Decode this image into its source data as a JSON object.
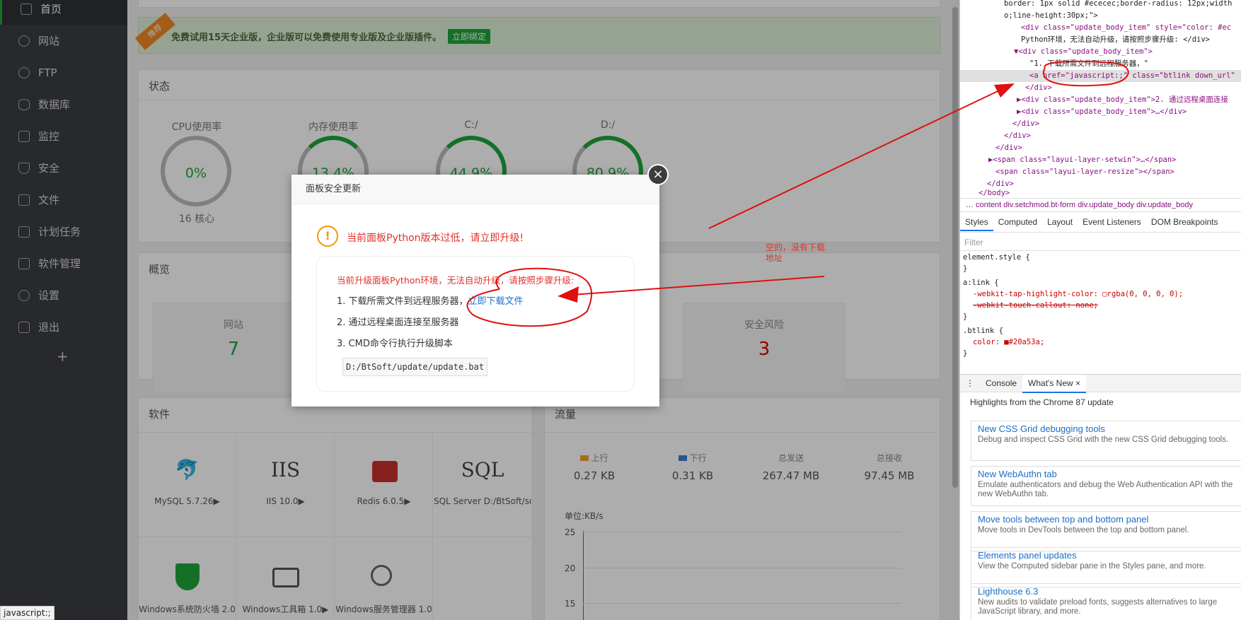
{
  "sidebar": {
    "items": [
      {
        "label": "首页",
        "icon": "home-icon"
      },
      {
        "label": "网站",
        "icon": "globe-icon"
      },
      {
        "label": "FTP",
        "icon": "ftp-icon"
      },
      {
        "label": "数据库",
        "icon": "database-icon"
      },
      {
        "label": "监控",
        "icon": "monitor-icon"
      },
      {
        "label": "安全",
        "icon": "shield-icon"
      },
      {
        "label": "文件",
        "icon": "folder-icon"
      },
      {
        "label": "计划任务",
        "icon": "calendar-icon"
      },
      {
        "label": "软件管理",
        "icon": "grid-icon"
      },
      {
        "label": "设置",
        "icon": "gear-icon"
      },
      {
        "label": "退出",
        "icon": "logout-icon"
      }
    ],
    "add": "+"
  },
  "promo": {
    "tag": "推荐",
    "text": "免费试用15天企业版，企业版可以免费使用专业版及企业版插件。",
    "button": "立即绑定"
  },
  "status": {
    "title": "状态",
    "gauges": [
      {
        "label": "CPU使用率",
        "value": "0%",
        "sub": "16 核心",
        "percent": 0
      },
      {
        "label": "内存使用率",
        "value": "13.4%",
        "sub": "",
        "percent": 13.4
      },
      {
        "label": "C:/",
        "value": "44.9%",
        "sub": "",
        "percent": 44.9
      },
      {
        "label": "D:/",
        "value": "80.9%",
        "sub": "",
        "percent": 80.9
      }
    ]
  },
  "overview": {
    "title": "概览",
    "boxes": [
      {
        "label": "网站",
        "value": "7"
      },
      {
        "label": "安全风险",
        "value": "3"
      }
    ]
  },
  "software": {
    "title": "软件",
    "items": [
      {
        "logo": "🐬",
        "name": "MySQL 5.7.26▶"
      },
      {
        "logo": "IIS",
        "name": "IIS 10.0▶"
      },
      {
        "logo": "",
        "name": "Redis 6.0.5▶"
      },
      {
        "logo": "SQL",
        "name": "SQL Server D:/BtSoft/sqlserver/versi"
      },
      {
        "logo": "",
        "name": "Windows系统防火墙 2.0"
      },
      {
        "logo": "",
        "name": "Windows工具箱 1.0▶"
      },
      {
        "logo": "",
        "name": "Windows服务管理器 1.0"
      }
    ]
  },
  "flow": {
    "title": "流量",
    "stats": [
      {
        "label": "上行",
        "value": "0.27 KB",
        "color": "#f0a030"
      },
      {
        "label": "下行",
        "value": "0.31 KB",
        "color": "#3a7fd5"
      },
      {
        "label": "总发送",
        "value": "267.47 MB"
      },
      {
        "label": "总接收",
        "value": "97.45 MB"
      }
    ],
    "unit": "单位:KB/s",
    "y_ticks": [
      "25",
      "20",
      "15"
    ]
  },
  "modal": {
    "title": "面板安全更新",
    "warning": "当前面板Python版本过低，请立即升级!",
    "intro": "当前升级面板Python环境，无法自动升级，请按照步骤升级:",
    "step1": "1. 下载所需文件到远程服务器，",
    "step1_link": "立即下载文件",
    "step2": "2. 通过远程桌面连接至服务器",
    "step3": "3. CMD命令行执行升级脚本",
    "code": "D:/BtSoft/update/update.bat",
    "close": "×"
  },
  "annotation": {
    "line1": "空的，没有下载",
    "line2": "地址"
  },
  "status_tip": "javascript:;",
  "devtools": {
    "dom": [
      "border: 1px solid #ececec;border-radius: 12px;width",
      "o;line-height:30px;\">",
      "<div class=\"update_body_item\" style=\"color: #ec",
      "Python环境，无法自动升级，请按照步骤升级: </div>",
      "▼<div class=\"update_body_item\">",
      "\"1. 下载所需文件到远程服务器，\"",
      "<a href=\"javascript:;\" class=\"btlink down_url\"",
      "</div>",
      "▶<div class=\"update_body_item\">2. 通过远程桌面连接",
      "▶<div class=\"update_body_item\">…</div>",
      "</div>",
      "</div>",
      "</div>",
      "▶<span class=\"layui-layer-setwin\">…</span>",
      "<span class=\"layui-layer-resize\"></span>",
      "</div>",
      "</body>"
    ],
    "breadcrumbs": "…  content   div.setchmod.bt-form   div.update_body   div.update_body",
    "tabs": [
      "Styles",
      "Computed",
      "Layout",
      "Event Listeners",
      "DOM Breakpoints"
    ],
    "filter": "Filter",
    "css": [
      "element.style {",
      "}",
      "a:link {",
      "-webkit-tap-highlight-color: ▢rgba(0, 0, 0, 0);",
      "-webkit-touch-callout: none;",
      "}",
      ".btlink {",
      "color: ■#20a53a;",
      "}"
    ],
    "console_tabs": [
      "Console",
      "What's New ×"
    ],
    "highlights": "Highlights from the Chrome 87 update",
    "news": [
      {
        "title": "New CSS Grid debugging tools",
        "desc": "Debug and inspect CSS Grid with the new CSS Grid debugging tools."
      },
      {
        "title": "New WebAuthn tab",
        "desc": "Emulate authenticators and debug the Web Authentication API with the new WebAuthn tab."
      },
      {
        "title": "Move tools between top and bottom panel",
        "desc": "Move tools in DevTools between the top and bottom panel."
      },
      {
        "title": "Elements panel updates",
        "desc": "View the Computed sidebar pane in the Styles pane, and more."
      },
      {
        "title": "Lighthouse 6.3",
        "desc": "New audits to validate preload fonts, suggests alternatives to large JavaScript library, and more."
      }
    ]
  }
}
